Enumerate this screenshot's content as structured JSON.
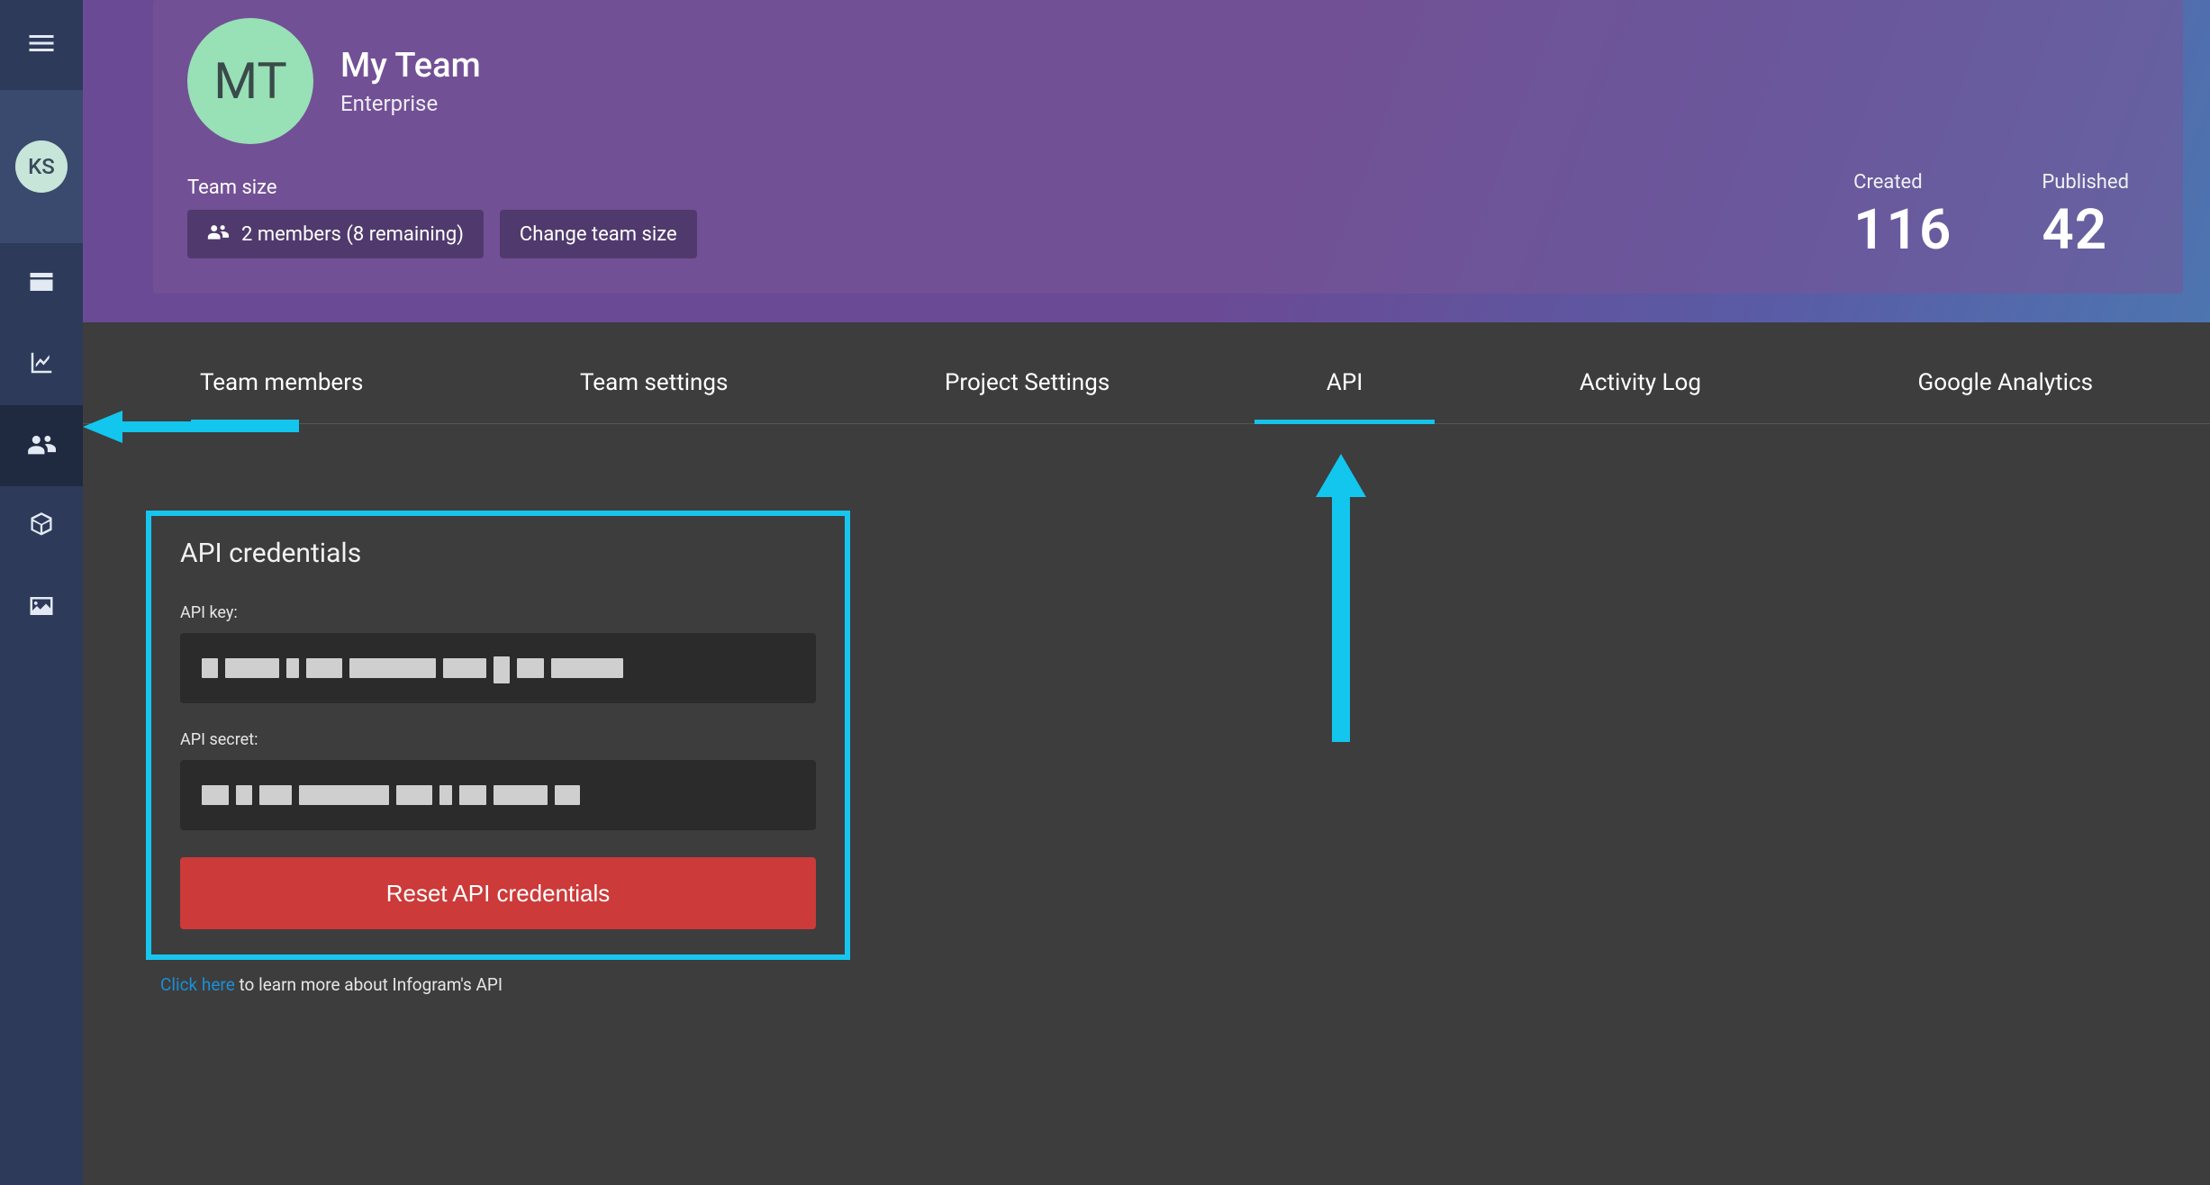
{
  "sidebar": {
    "avatar_initials": "KS"
  },
  "header": {
    "team_avatar_initials": "MT",
    "team_name": "My Team",
    "plan": "Enterprise",
    "team_size_label": "Team size",
    "members_chip": "2 members (8 remaining)",
    "change_size_chip": "Change team size",
    "created_label": "Created",
    "created_count": "116",
    "published_label": "Published",
    "published_count": "42"
  },
  "tabs": [
    {
      "label": "Team members"
    },
    {
      "label": "Team settings"
    },
    {
      "label": "Project Settings"
    },
    {
      "label": "API"
    },
    {
      "label": "Activity Log"
    },
    {
      "label": "Google Analytics"
    }
  ],
  "api": {
    "title": "API credentials",
    "key_label": "API key:",
    "secret_label": "API secret:",
    "reset_button": "Reset API credentials",
    "learn_link": "Click here",
    "learn_rest": " to learn more about Infogram's API"
  }
}
